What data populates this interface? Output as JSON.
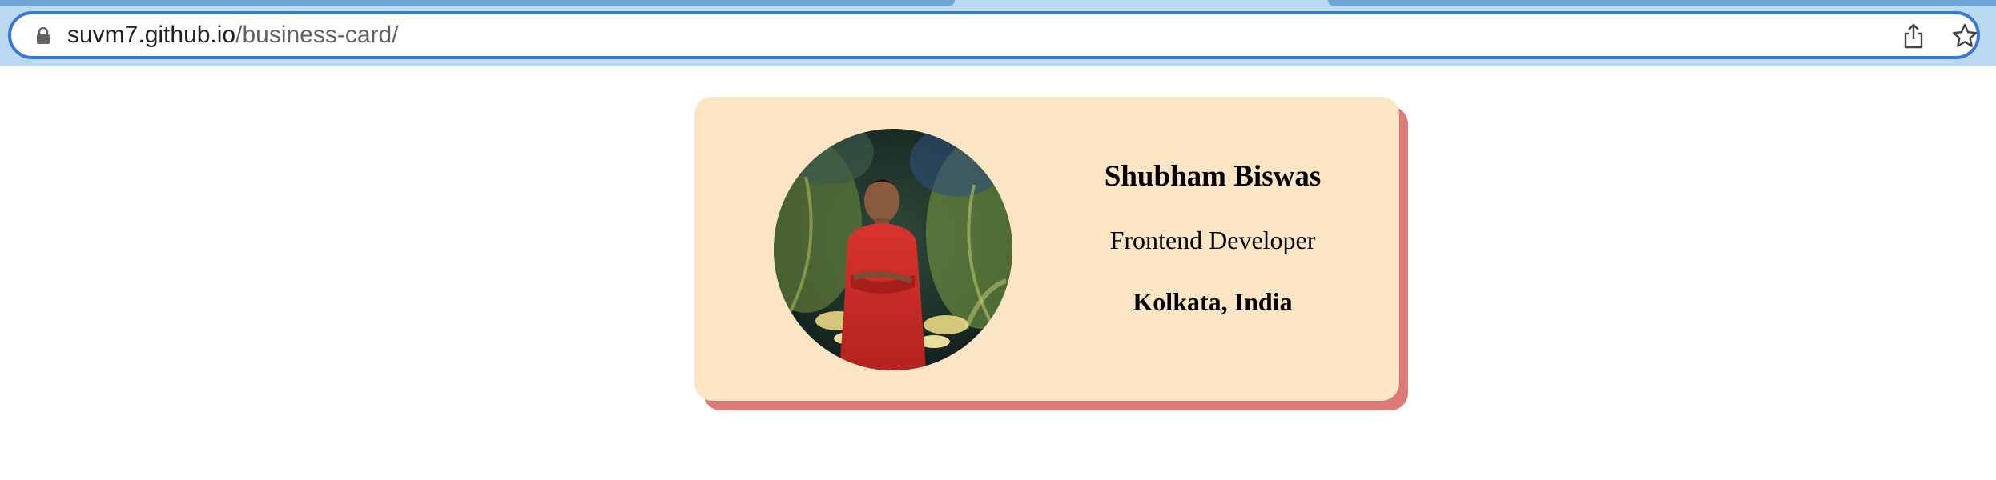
{
  "browser": {
    "url": {
      "host": "suvm7.github.io",
      "path": "/business-card/"
    },
    "icons": {
      "lock": "lock-icon",
      "share": "share-icon",
      "bookmark": "star-icon"
    },
    "colors": {
      "toolbar": "#bcd9f2",
      "omnibox_border": "#3a78d8"
    }
  },
  "card": {
    "name": "Shubham Biswas",
    "role": "Frontend Developer",
    "location": "Kolkata, India",
    "colors": {
      "background": "#fce5c4",
      "shadow": "#dc7a78"
    }
  }
}
